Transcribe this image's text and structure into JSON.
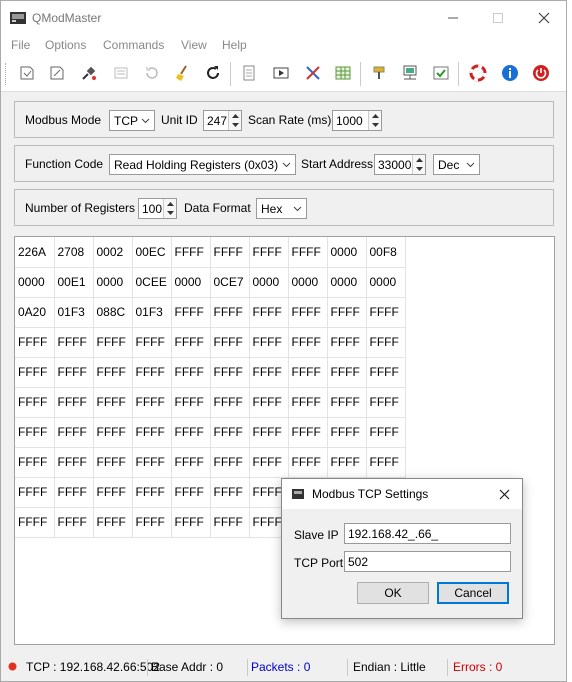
{
  "window": {
    "title": "QModMaster"
  },
  "menu": [
    "File",
    "Options",
    "Commands",
    "View",
    "Help"
  ],
  "toolbar": {
    "icons": [
      "connect-icon",
      "edit-icon",
      "plug-icon",
      "scan-icon",
      "reset-icon",
      "clear-icon",
      "refresh-icon",
      "log-icon",
      "monitor-icon",
      "tools-icon",
      "table-icon",
      "settings-icon",
      "bus-monitor-icon",
      "check-icon",
      "help-ring-icon",
      "info-icon",
      "exit-icon"
    ]
  },
  "mode_group": {
    "modbus_mode_label": "Modbus Mode",
    "modbus_mode_value": "TCP",
    "unit_id_label": "Unit ID",
    "unit_id_value": "247",
    "scan_rate_label": "Scan Rate (ms)",
    "scan_rate_value": "1000"
  },
  "function_group": {
    "function_code_label": "Function Code",
    "function_code_value": "Read Holding Registers (0x03)",
    "start_address_label": "Start Address",
    "start_address_value": "33000",
    "address_format_value": "Dec"
  },
  "registers_group": {
    "number_label": "Number of Registers",
    "number_value": "100",
    "data_format_label": "Data Format",
    "data_format_value": "Hex"
  },
  "grid": {
    "rows": [
      [
        "226A",
        "2708",
        "0002",
        "00EC",
        "FFFF",
        "FFFF",
        "FFFF",
        "FFFF",
        "0000",
        "00F8"
      ],
      [
        "0000",
        "00E1",
        "0000",
        "0CEE",
        "0000",
        "0CE7",
        "0000",
        "0000",
        "0000",
        "0000"
      ],
      [
        "0A20",
        "01F3",
        "088C",
        "01F3",
        "FFFF",
        "FFFF",
        "FFFF",
        "FFFF",
        "FFFF",
        "FFFF"
      ],
      [
        "FFFF",
        "FFFF",
        "FFFF",
        "FFFF",
        "FFFF",
        "FFFF",
        "FFFF",
        "FFFF",
        "FFFF",
        "FFFF"
      ],
      [
        "FFFF",
        "FFFF",
        "FFFF",
        "FFFF",
        "FFFF",
        "FFFF",
        "FFFF",
        "FFFF",
        "FFFF",
        "FFFF"
      ],
      [
        "FFFF",
        "FFFF",
        "FFFF",
        "FFFF",
        "FFFF",
        "FFFF",
        "FFFF",
        "FFFF",
        "FFFF",
        "FFFF"
      ],
      [
        "FFFF",
        "FFFF",
        "FFFF",
        "FFFF",
        "FFFF",
        "FFFF",
        "FFFF",
        "FFFF",
        "FFFF",
        "FFFF"
      ],
      [
        "FFFF",
        "FFFF",
        "FFFF",
        "FFFF",
        "FFFF",
        "FFFF",
        "FFFF",
        "FFFF",
        "FFFF",
        "FFFF"
      ],
      [
        "FFFF",
        "FFFF",
        "FFFF",
        "FFFF",
        "FFFF",
        "FFFF",
        "FFFF",
        "FFFF",
        "FFFF",
        "FFFF"
      ],
      [
        "FFFF",
        "FFFF",
        "FFFF",
        "FFFF",
        "FFFF",
        "FFFF",
        "FFFF",
        "FFFF",
        "FFFF",
        "FFFF"
      ]
    ]
  },
  "dialog": {
    "title": "Modbus TCP Settings",
    "slave_ip_label": "Slave IP",
    "slave_ip_value": "192.168.42_.66_",
    "tcp_port_label": "TCP Port",
    "tcp_port_value": "502",
    "ok_label": "OK",
    "cancel_label": "Cancel"
  },
  "status": {
    "connection": "TCP : 192.168.42.66:502",
    "base_addr": "Base Addr : 0",
    "packets": "Packets : 0",
    "endian": "Endian : Little",
    "errors": "Errors : 0",
    "colors": {
      "packets": "#0000cc",
      "errors": "#cc0000",
      "indicator": "#e03020"
    }
  }
}
